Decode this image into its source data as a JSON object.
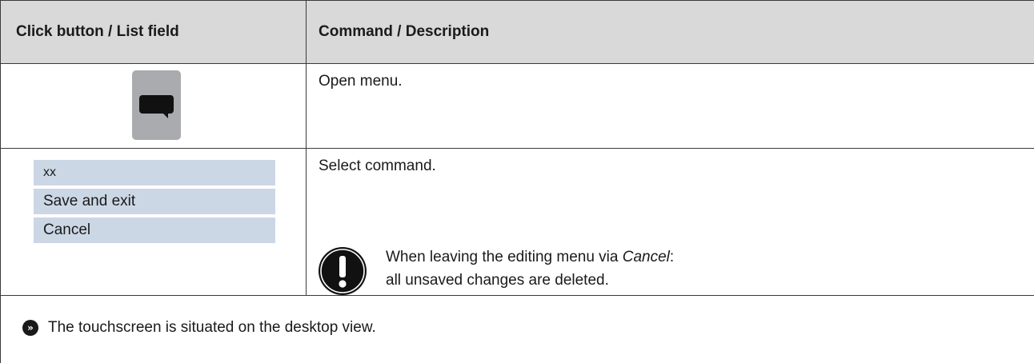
{
  "table": {
    "headers": [
      "Click button / List field",
      "Command / Description"
    ],
    "rows": [
      {
        "icon": "speech-bubble-icon",
        "description": "Open menu."
      },
      {
        "options": [
          "xx",
          "Save and exit",
          "Cancel"
        ],
        "description": "Select command.",
        "note": {
          "icon": "exclamation-icon",
          "line1_prefix": "When leaving the editing menu via ",
          "line1_emph": "Cancel",
          "line1_suffix": ":",
          "line2": "all unsaved changes are deleted."
        }
      }
    ],
    "result": {
      "icon": "double-chevron-right-icon",
      "text": "The touchscreen is situated on the desktop view."
    }
  },
  "colors": {
    "header_bg": "#d9d9d9",
    "button_bg": "#a9abae",
    "option_bg": "#ccd7e6",
    "rule": "#3a3a3a"
  }
}
